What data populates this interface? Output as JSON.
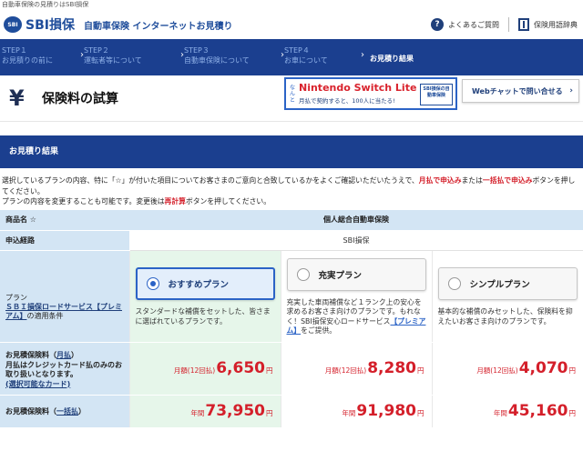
{
  "top_note": "自動車保険の見積りはSBI損保",
  "header": {
    "logo_mark": "SBI",
    "logo_text": "SBI損保",
    "subtitle": "自動車保険 インターネットお見積り",
    "faq": "よくあるご質問",
    "glossary": "保険用語辞典"
  },
  "steps": [
    {
      "num": "STEP１",
      "label": "お見積りの前に"
    },
    {
      "num": "STEP２",
      "label": "運転者等について"
    },
    {
      "num": "STEP３",
      "label": "自動車保険について"
    },
    {
      "num": "STEP４",
      "label": "お車について"
    },
    {
      "num": "",
      "label": "お見積り結果"
    }
  ],
  "title": {
    "yen": "¥",
    "text": "保険料の試算"
  },
  "banner": {
    "vertical": "なんと",
    "product": "Nintendo Switch Lite",
    "line": "月払で契約すると、100人に当たる!",
    "badge": "SBI損保の自動車保険"
  },
  "chat_button": "Webチャットで問い合せる",
  "result_header": "お見積り結果",
  "description": {
    "p1_a": "選択しているプランの内容、特に「☆」が付いた項目についてお客さまのご意向と合致しているかをよくご確認いただいたうえで、",
    "p1_red1": "月払で申込み",
    "p1_b": "または",
    "p1_red2": "一括払で申込み",
    "p1_c": "ボタンを押してください。",
    "p2_a": "プランの内容を変更することも可能です。変更後は",
    "p2_red": "再計算",
    "p2_b": "ボタンを押してください。"
  },
  "table": {
    "product_label": "商品名 ☆",
    "product_value": "個人総合自動車保険",
    "route_label": "申込経路",
    "route_value": "SBI損保",
    "plan_label_a": "プラン",
    "plan_label_link": "ＳＢＩ損保ロードサービス【プレミアム】",
    "plan_label_b": "の適用条件",
    "monthly_label_a": "お見積保険料（",
    "monthly_label_link": "月払",
    "monthly_label_b": "）",
    "monthly_note_a": "月払はクレジットカード払のみのお取り扱いとなります。",
    "monthly_note_link": "(選択可能なカード)",
    "annual_label_a": "お見積保険料（",
    "annual_label_link": "一括払",
    "annual_label_b": "）",
    "monthly_prefix": "月額(12回払)",
    "annual_prefix": "年間",
    "currency": "円",
    "plans": [
      {
        "name": "おすすめプラン",
        "selected": true,
        "desc": "スタンダードな補償をセットした、皆さまに選ばれているプランです。",
        "monthly": "6,650",
        "annual": "73,950"
      },
      {
        "name": "充実プラン",
        "selected": false,
        "desc_a": "充実した車両補償など１ランク上の安心を求めるお客さま向けのプランです。もれなく！SBI損保安心ロードサービス",
        "desc_link": "【プレミアム】",
        "desc_b": "をご提供。",
        "monthly": "8,280",
        "annual": "91,980"
      },
      {
        "name": "シンプルプラン",
        "selected": false,
        "desc": "基本的な補償のみセットした、保険料を抑えたいお客さま向けのプランです。",
        "monthly": "4,070",
        "annual": "45,160"
      }
    ]
  }
}
